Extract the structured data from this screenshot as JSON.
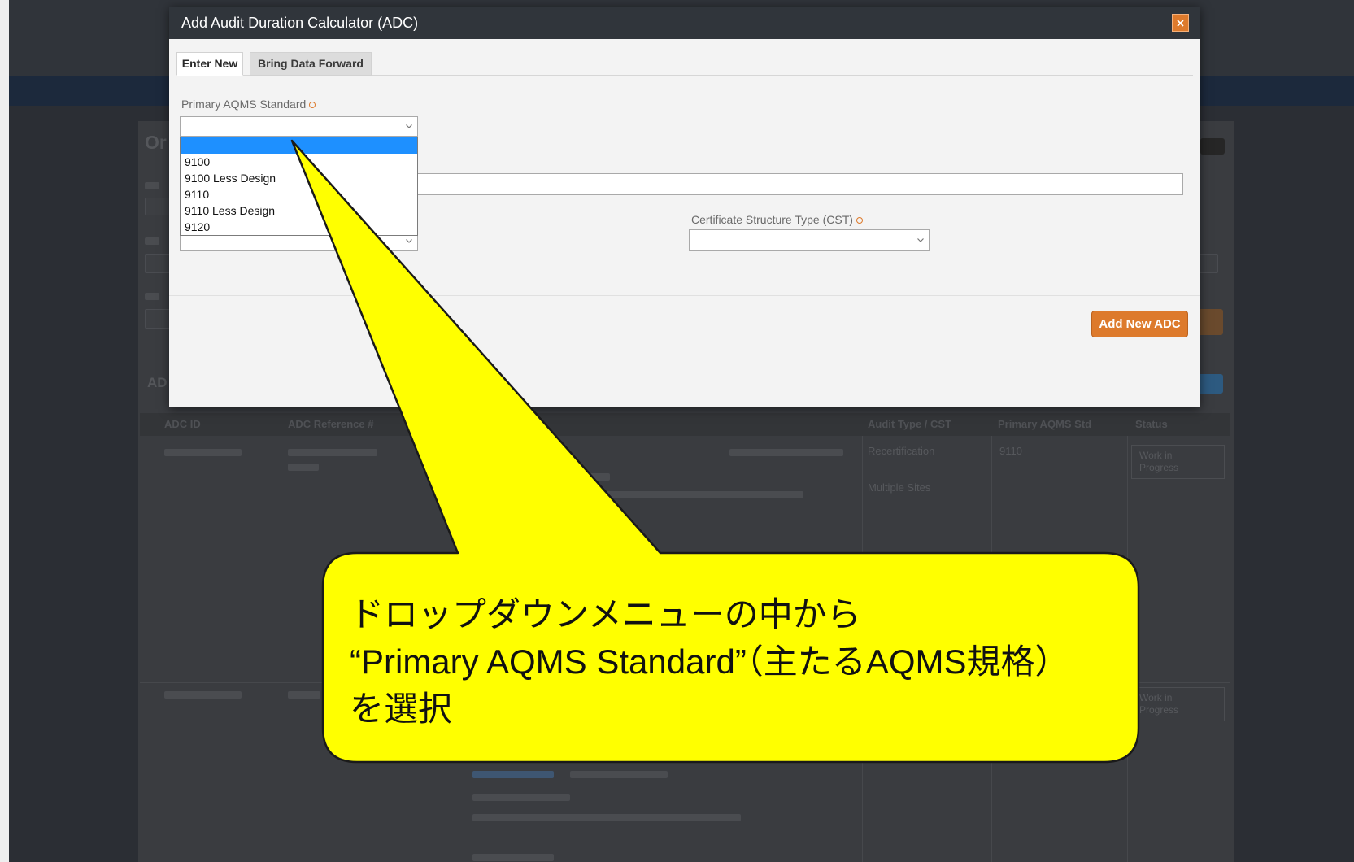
{
  "modal": {
    "title": "Add Audit Duration Calculator (ADC)",
    "close_icon": "close-icon",
    "tabs": [
      {
        "label": "Enter New",
        "active": true
      },
      {
        "label": "Bring Data Forward",
        "active": false
      }
    ],
    "primary_standard": {
      "label": "Primary AQMS Standard",
      "required_icon": "required-icon",
      "selected": "",
      "dropdown_open": true,
      "highlighted_index": 0,
      "options": [
        "",
        "9100",
        "9100 Less Design",
        "9110",
        "9110 Less Design",
        "9120"
      ]
    },
    "text_field": {
      "value": ""
    },
    "secondary_select": {
      "selected": ""
    },
    "cst": {
      "label": "Certificate Structure Type (CST)",
      "required_icon": "required-icon",
      "selected": ""
    },
    "add_button_label": "Add New ADC"
  },
  "callout": {
    "lines": [
      "ドロップダウンメニューの中から",
      "“Primary AQMS Standard”（主たるAQMS規格）",
      "を選択"
    ]
  },
  "background_page": {
    "heading_fragment": "Or",
    "section_fragment": "AD",
    "table_headers": [
      "ADC ID",
      "ADC Reference #",
      "Audit Type / CST",
      "Primary AQMS Std",
      "Status"
    ],
    "rows": [
      {
        "audit_type": "Recertification",
        "site_type": "Multiple Sites",
        "primary_std": "9110",
        "status": "Work in Progress"
      },
      {
        "status": "Work in Progress"
      }
    ]
  },
  "icons": {
    "select_arrow": "chevron-down-icon",
    "close": "close-icon",
    "required": "required-icon"
  },
  "colors": {
    "accent": "#dd7a2c",
    "option_highlight": "#1e90ff",
    "callout_fill": "#ffff00",
    "title_bar": "#30353b"
  }
}
